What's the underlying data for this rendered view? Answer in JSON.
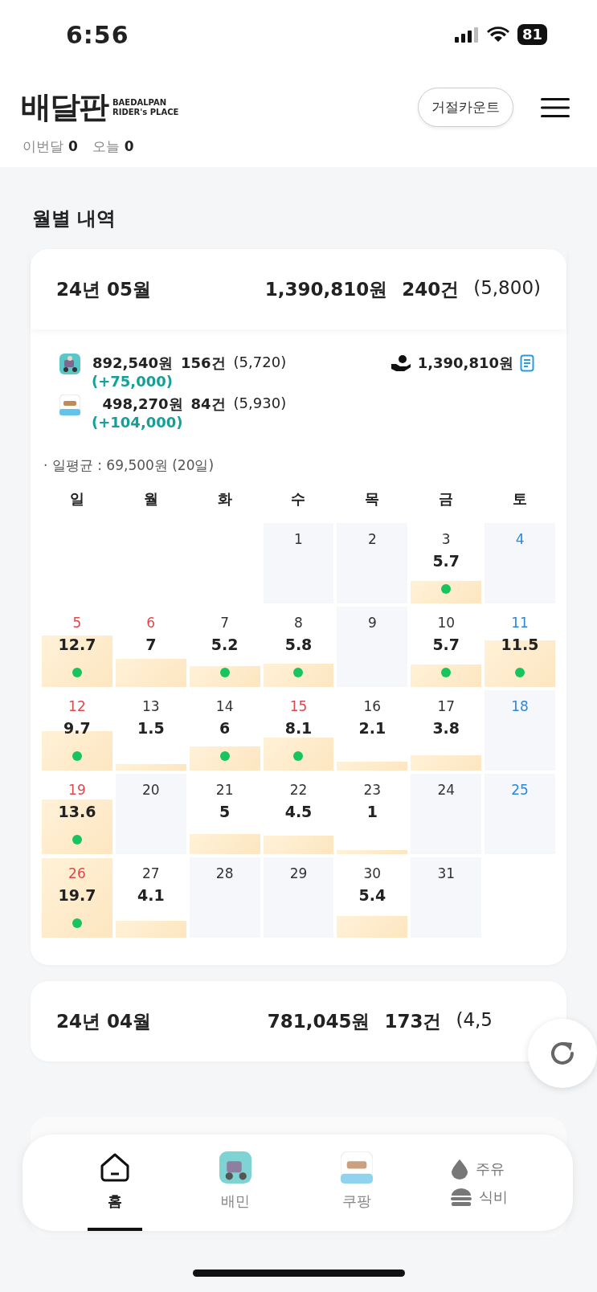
{
  "status_bar": {
    "time": "6:56",
    "battery": "81"
  },
  "header": {
    "logo": "배달판",
    "tagline_1": "BAEDALPAN",
    "tagline_2": "RIDER's PLACE",
    "button": "거절카운트",
    "stats": [
      {
        "label": "이번달",
        "value": "0"
      },
      {
        "label": "오늘",
        "value": "0"
      }
    ]
  },
  "section_title": "월별 내역",
  "months": [
    {
      "title": "24년 05월",
      "amount": "1,390,810원",
      "count": "240건",
      "average": "(5,800)",
      "expanded": true,
      "platforms": [
        {
          "amount": "892,540원",
          "count": "156건",
          "average": "(5,720)",
          "bonus": "(+75,000)"
        },
        {
          "amount": "498,270원",
          "count": "84건",
          "average": "(5,930)",
          "bonus": "(+104,000)"
        }
      ],
      "total": "1,390,810원",
      "daily_average": "· 일평균 : 69,500원 (20일)",
      "weekdays": [
        {
          "label": "일"
        },
        {
          "label": "월"
        },
        {
          "label": "화"
        },
        {
          "label": "수"
        },
        {
          "label": "목"
        },
        {
          "label": "금"
        },
        {
          "label": "토"
        }
      ],
      "weeks": [
        [
          {
            "kind": "blank"
          },
          {
            "kind": "blank"
          },
          {
            "kind": "blank"
          },
          {
            "kind": "day",
            "day": "1",
            "color": "#333333"
          },
          {
            "kind": "day",
            "day": "2",
            "color": "#333333"
          },
          {
            "kind": "day",
            "day": "3",
            "color": "#333333",
            "value": "5.7",
            "level": 0.28,
            "dot": true
          },
          {
            "kind": "day",
            "day": "4",
            "color": "#2a88dc"
          }
        ],
        [
          {
            "kind": "day",
            "day": "5",
            "color": "#e0474c",
            "value": "12.7",
            "level": 0.64,
            "dot": true
          },
          {
            "kind": "day",
            "day": "6",
            "color": "#e0474c",
            "value": "7",
            "level": 0.35,
            "dot": false
          },
          {
            "kind": "day",
            "day": "7",
            "color": "#333333",
            "value": "5.2",
            "level": 0.26,
            "dot": true
          },
          {
            "kind": "day",
            "day": "8",
            "color": "#333333",
            "value": "5.8",
            "level": 0.29,
            "dot": true
          },
          {
            "kind": "day",
            "day": "9",
            "color": "#333333"
          },
          {
            "kind": "day",
            "day": "10",
            "color": "#333333",
            "value": "5.7",
            "level": 0.28,
            "dot": true
          },
          {
            "kind": "day",
            "day": "11",
            "color": "#2a88dc",
            "value": "11.5",
            "level": 0.58,
            "dot": true
          }
        ],
        [
          {
            "kind": "day",
            "day": "12",
            "color": "#e0474c",
            "value": "9.7",
            "level": 0.49,
            "dot": true
          },
          {
            "kind": "day",
            "day": "13",
            "color": "#333333",
            "value": "1.5",
            "level": 0.08,
            "dot": false
          },
          {
            "kind": "day",
            "day": "14",
            "color": "#333333",
            "value": "6",
            "level": 0.3,
            "dot": true
          },
          {
            "kind": "day",
            "day": "15",
            "color": "#e0474c",
            "value": "8.1",
            "level": 0.41,
            "dot": true
          },
          {
            "kind": "day",
            "day": "16",
            "color": "#333333",
            "value": "2.1",
            "level": 0.11,
            "dot": false
          },
          {
            "kind": "day",
            "day": "17",
            "color": "#333333",
            "value": "3.8",
            "level": 0.19,
            "dot": false
          },
          {
            "kind": "day",
            "day": "18",
            "color": "#2a88dc"
          }
        ],
        [
          {
            "kind": "day",
            "day": "19",
            "color": "#e0474c",
            "value": "13.6",
            "level": 0.68,
            "dot": true
          },
          {
            "kind": "day",
            "day": "20",
            "color": "#333333"
          },
          {
            "kind": "day",
            "day": "21",
            "color": "#333333",
            "value": "5",
            "level": 0.25,
            "dot": false
          },
          {
            "kind": "day",
            "day": "22",
            "color": "#333333",
            "value": "4.5",
            "level": 0.23,
            "dot": false
          },
          {
            "kind": "day",
            "day": "23",
            "color": "#333333",
            "value": "1",
            "level": 0.05,
            "dot": false
          },
          {
            "kind": "day",
            "day": "24",
            "color": "#333333"
          },
          {
            "kind": "day",
            "day": "25",
            "color": "#2a88dc"
          }
        ],
        [
          {
            "kind": "day",
            "day": "26",
            "color": "#e0474c",
            "value": "19.7",
            "level": 0.99,
            "dot": true
          },
          {
            "kind": "day",
            "day": "27",
            "color": "#333333",
            "value": "4.1",
            "level": 0.21,
            "dot": false
          },
          {
            "kind": "day",
            "day": "28",
            "color": "#333333"
          },
          {
            "kind": "day",
            "day": "29",
            "color": "#333333"
          },
          {
            "kind": "day",
            "day": "30",
            "color": "#333333",
            "value": "5.4",
            "level": 0.27,
            "dot": false
          },
          {
            "kind": "day",
            "day": "31",
            "color": "#333333"
          },
          {
            "kind": "blank"
          }
        ]
      ]
    },
    {
      "title": "24년 04월",
      "amount": "781,045원",
      "count": "173건",
      "average": "(4,5",
      "expanded": false
    }
  ],
  "nav": {
    "tabs": [
      {
        "label": "홈",
        "selected": true
      },
      {
        "label": "배민",
        "selected": false
      },
      {
        "label": "쿠팡",
        "selected": false
      }
    ],
    "shortcuts": [
      {
        "label": "주유"
      },
      {
        "label": "식비"
      }
    ]
  }
}
